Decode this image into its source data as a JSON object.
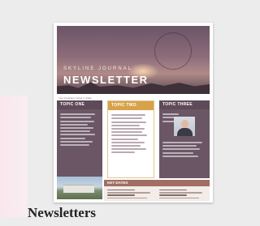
{
  "template": {
    "caption": "Newsletters",
    "hero": {
      "small_title": "Skyline Journal",
      "big_title": "NEWSLETTER",
      "meta": "Your Company | Issue 1 | Date"
    },
    "columns": [
      {
        "title": "Topic One"
      },
      {
        "title": "Topic Two"
      },
      {
        "title": "Topic Three"
      }
    ],
    "key_dates": {
      "title": "Key Dates"
    }
  },
  "icons": {
    "photo_building": "building-photo",
    "photo_person": "person-photo"
  },
  "colors": {
    "mauve": "#6a5664",
    "gold": "#d7a24a",
    "rose": "#a26e63",
    "pink_accent": "#fbe6ee"
  }
}
